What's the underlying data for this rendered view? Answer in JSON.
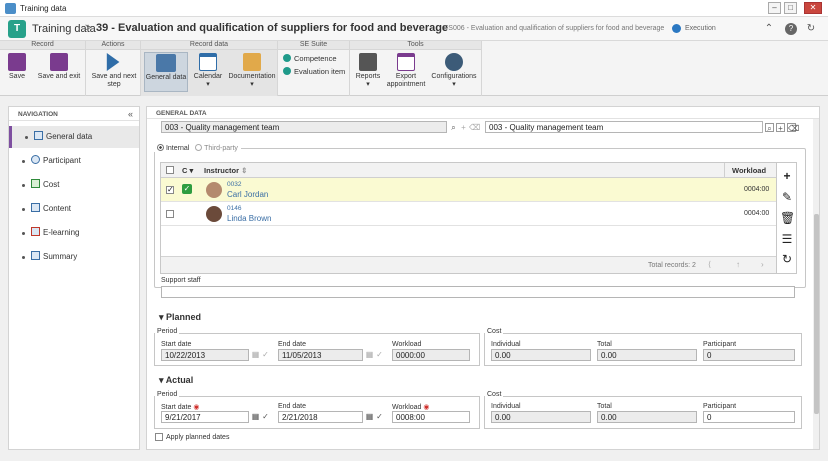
{
  "window": {
    "title": "Training data"
  },
  "header": {
    "module": "Training data",
    "separator": ">",
    "record_title": "39 - Evaluation and qualification of suppliers for food and beverage",
    "record_code": "FS006 - Evaluation and qualification of suppliers for food and beverage",
    "execution": "Execution"
  },
  "ribbon": {
    "groups": {
      "record": "Record",
      "actions": "Actions",
      "record_data": "Record data",
      "se_suite": "SE Suite",
      "tools": "Tools"
    },
    "buttons": {
      "save": "Save",
      "save_exit": "Save and exit",
      "save_next": "Save and next",
      "save_next_2": "step",
      "general_data": "General data",
      "calendar": "Calendar",
      "documentation": "Documentation",
      "competence": "Competence",
      "evaluation_item": "Evaluation item",
      "reports": "Reports",
      "export": "Export",
      "export_2": "appointment",
      "configurations": "Configurations"
    }
  },
  "nav": {
    "heading": "NAVIGATION",
    "items": [
      {
        "label": "General data"
      },
      {
        "label": "Participant"
      },
      {
        "label": "Cost"
      },
      {
        "label": "Content"
      },
      {
        "label": "E-learning"
      },
      {
        "label": "Summary"
      }
    ]
  },
  "main": {
    "heading": "GENERAL DATA",
    "team_left": "003 - Quality management team",
    "team_right": "003 - Quality management team",
    "radio_internal": "Internal",
    "radio_third": "Third-party",
    "grid": {
      "col_c": "C",
      "col_instructor": "Instructor",
      "col_workload": "Workload",
      "rows": [
        {
          "code": "0032",
          "name": "Carl Jordan",
          "workload": "0004:00"
        },
        {
          "code": "0146",
          "name": "Linda Brown",
          "workload": "0004:00"
        }
      ],
      "total": "Total records: 2"
    },
    "support_staff": "Support staff",
    "planned": {
      "title": "Planned",
      "period": "Period",
      "start_label": "Start date",
      "start": "10/22/2013",
      "end_label": "End date",
      "end": "11/05/2013",
      "workload_label": "Workload",
      "workload": "0000:00",
      "cost": "Cost",
      "individual_label": "Individual",
      "individual": "0.00",
      "total_label": "Total",
      "total": "0.00",
      "participant_label": "Participant",
      "participant": "0"
    },
    "actual": {
      "title": "Actual",
      "period": "Period",
      "start_label": "Start date",
      "start": "9/21/2017",
      "end_label": "End date",
      "end": "2/21/2018",
      "workload_label": "Workload",
      "workload": "0008:00",
      "cost": "Cost",
      "individual_label": "Individual",
      "individual": "0.00",
      "total_label": "Total",
      "total": "0.00",
      "participant_label": "Participant",
      "participant": "0"
    },
    "apply_planned": "Apply planned dates"
  }
}
